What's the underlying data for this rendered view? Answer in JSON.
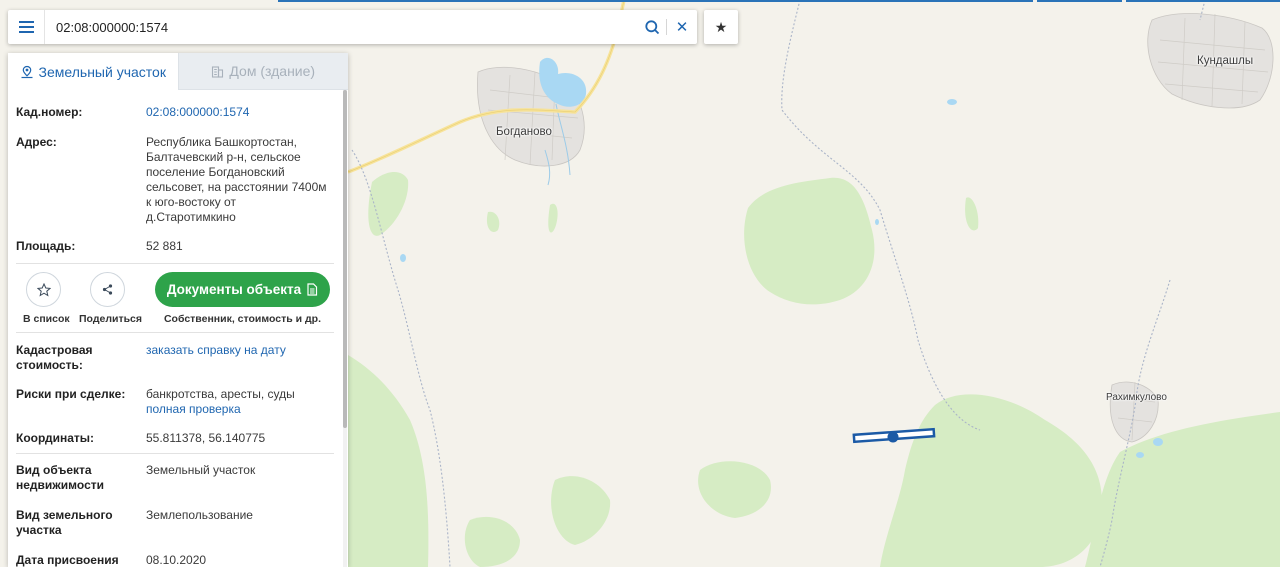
{
  "search": {
    "value": "02:08:000000:1574",
    "placeholder": ""
  },
  "tabs": [
    {
      "label": "Земельный участок",
      "active": true
    },
    {
      "label": "Дом (здание)",
      "active": false
    }
  ],
  "info": {
    "cad_number": {
      "label": "Кад.номер:",
      "value": "02:08:000000:1574"
    },
    "address": {
      "label": "Адрес:",
      "lines": [
        "Республика Башкортостан,",
        "Балтачевский р-н, сельское",
        "поселение Богдановский",
        "сельсовет, на расстоянии 7400м",
        "к юго-востоку от",
        "д.Старотимкино"
      ]
    },
    "area": {
      "label": "Площадь:",
      "value": "52 881"
    }
  },
  "actions": {
    "add_list": "В список",
    "share": "Поделиться",
    "docs_button": "Документы объекта",
    "docs_sub": "Собственник, стоимость и др."
  },
  "details": {
    "cost": {
      "label_lines": [
        "Кадастровая",
        "стоимость:"
      ],
      "value": "заказать справку на дату"
    },
    "risks": {
      "label": "Риски при сделке:",
      "value": "банкротства, аресты, суды",
      "link": "полная проверка"
    },
    "coords": {
      "label": "Координаты:",
      "value": "55.811378, 56.140775"
    },
    "object_type": {
      "label_lines": [
        "Вид объекта",
        "недвижимости"
      ],
      "value": "Земельный участок"
    },
    "land_type": {
      "label_lines": [
        "Вид земельного",
        "участка"
      ],
      "value": "Землепользование"
    },
    "assign_date": {
      "label": "Дата присвоения",
      "value": "08.10.2020"
    }
  },
  "map": {
    "places": [
      "Богданово",
      "Кундашлы",
      "Рахимкулово"
    ],
    "colors": {
      "forest": "#d6ecc4",
      "water": "#a9d8f3",
      "road": "#f7e39a",
      "parcel": "#1b5aa6",
      "accent": "#1f66b0",
      "docs_button": "#2ea34a"
    }
  },
  "icons": [
    "menu-icon",
    "search-icon",
    "close-icon",
    "star-icon",
    "land-plot-icon",
    "building-icon",
    "share-icon",
    "document-icon"
  ]
}
